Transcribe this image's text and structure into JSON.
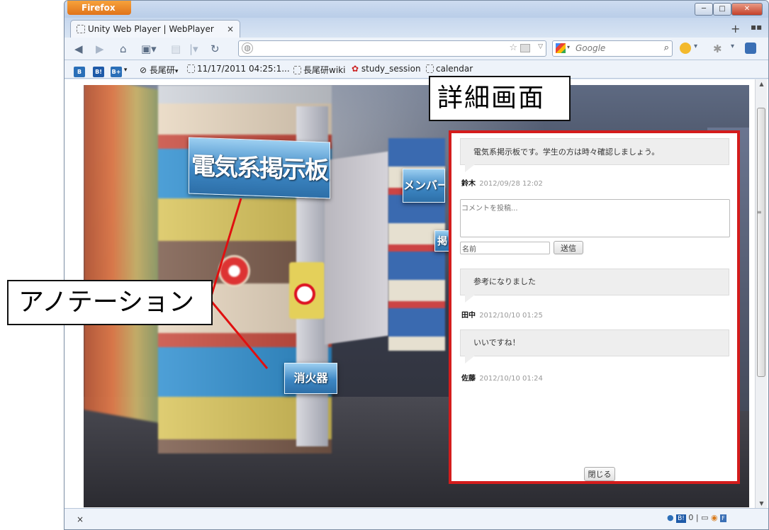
{
  "browser": {
    "menu_button": "Firefox",
    "tab_title": "Unity Web Player | WebPlayer",
    "tab_close": "×",
    "new_tab": "+",
    "search_placeholder": "Google",
    "window_buttons": {
      "minimize": "─",
      "maximize": "□",
      "close": "✕"
    }
  },
  "bookmarks": [
    {
      "label": "長尾研"
    },
    {
      "label": "11/17/2011 04:25:1..."
    },
    {
      "label": "長尾研wiki"
    },
    {
      "label": "study_session"
    },
    {
      "label": "calendar"
    }
  ],
  "scene": {
    "label_board": "電気系掲示板",
    "label_member": "メンバー募",
    "label_partial": "掲",
    "label_fire": "消火器"
  },
  "detail_panel": {
    "comments": [
      {
        "text": "電気系掲示板です。学生の方は時々確認しましょう。",
        "author": "鈴木",
        "time": "2012/09/28 12:02"
      },
      {
        "text": "参考になりました",
        "author": "田中",
        "time": "2012/10/10 01:25"
      },
      {
        "text": "いいですね！",
        "author": "佐藤",
        "time": "2012/10/10 01:24"
      }
    ],
    "comment_placeholder": "コメントを投稿...",
    "name_value": "名前",
    "send_label": "送信",
    "close_label": "閉じる"
  },
  "status_bar": {
    "close_x": "×",
    "right_text": "0 | ▭"
  },
  "callouts": {
    "annotation": "アノテーション",
    "detail": "詳細画面"
  },
  "colors": {
    "panel_border": "#d41c1c",
    "label_blue": "#3d87c4",
    "firefox_orange": "#e0731b"
  }
}
